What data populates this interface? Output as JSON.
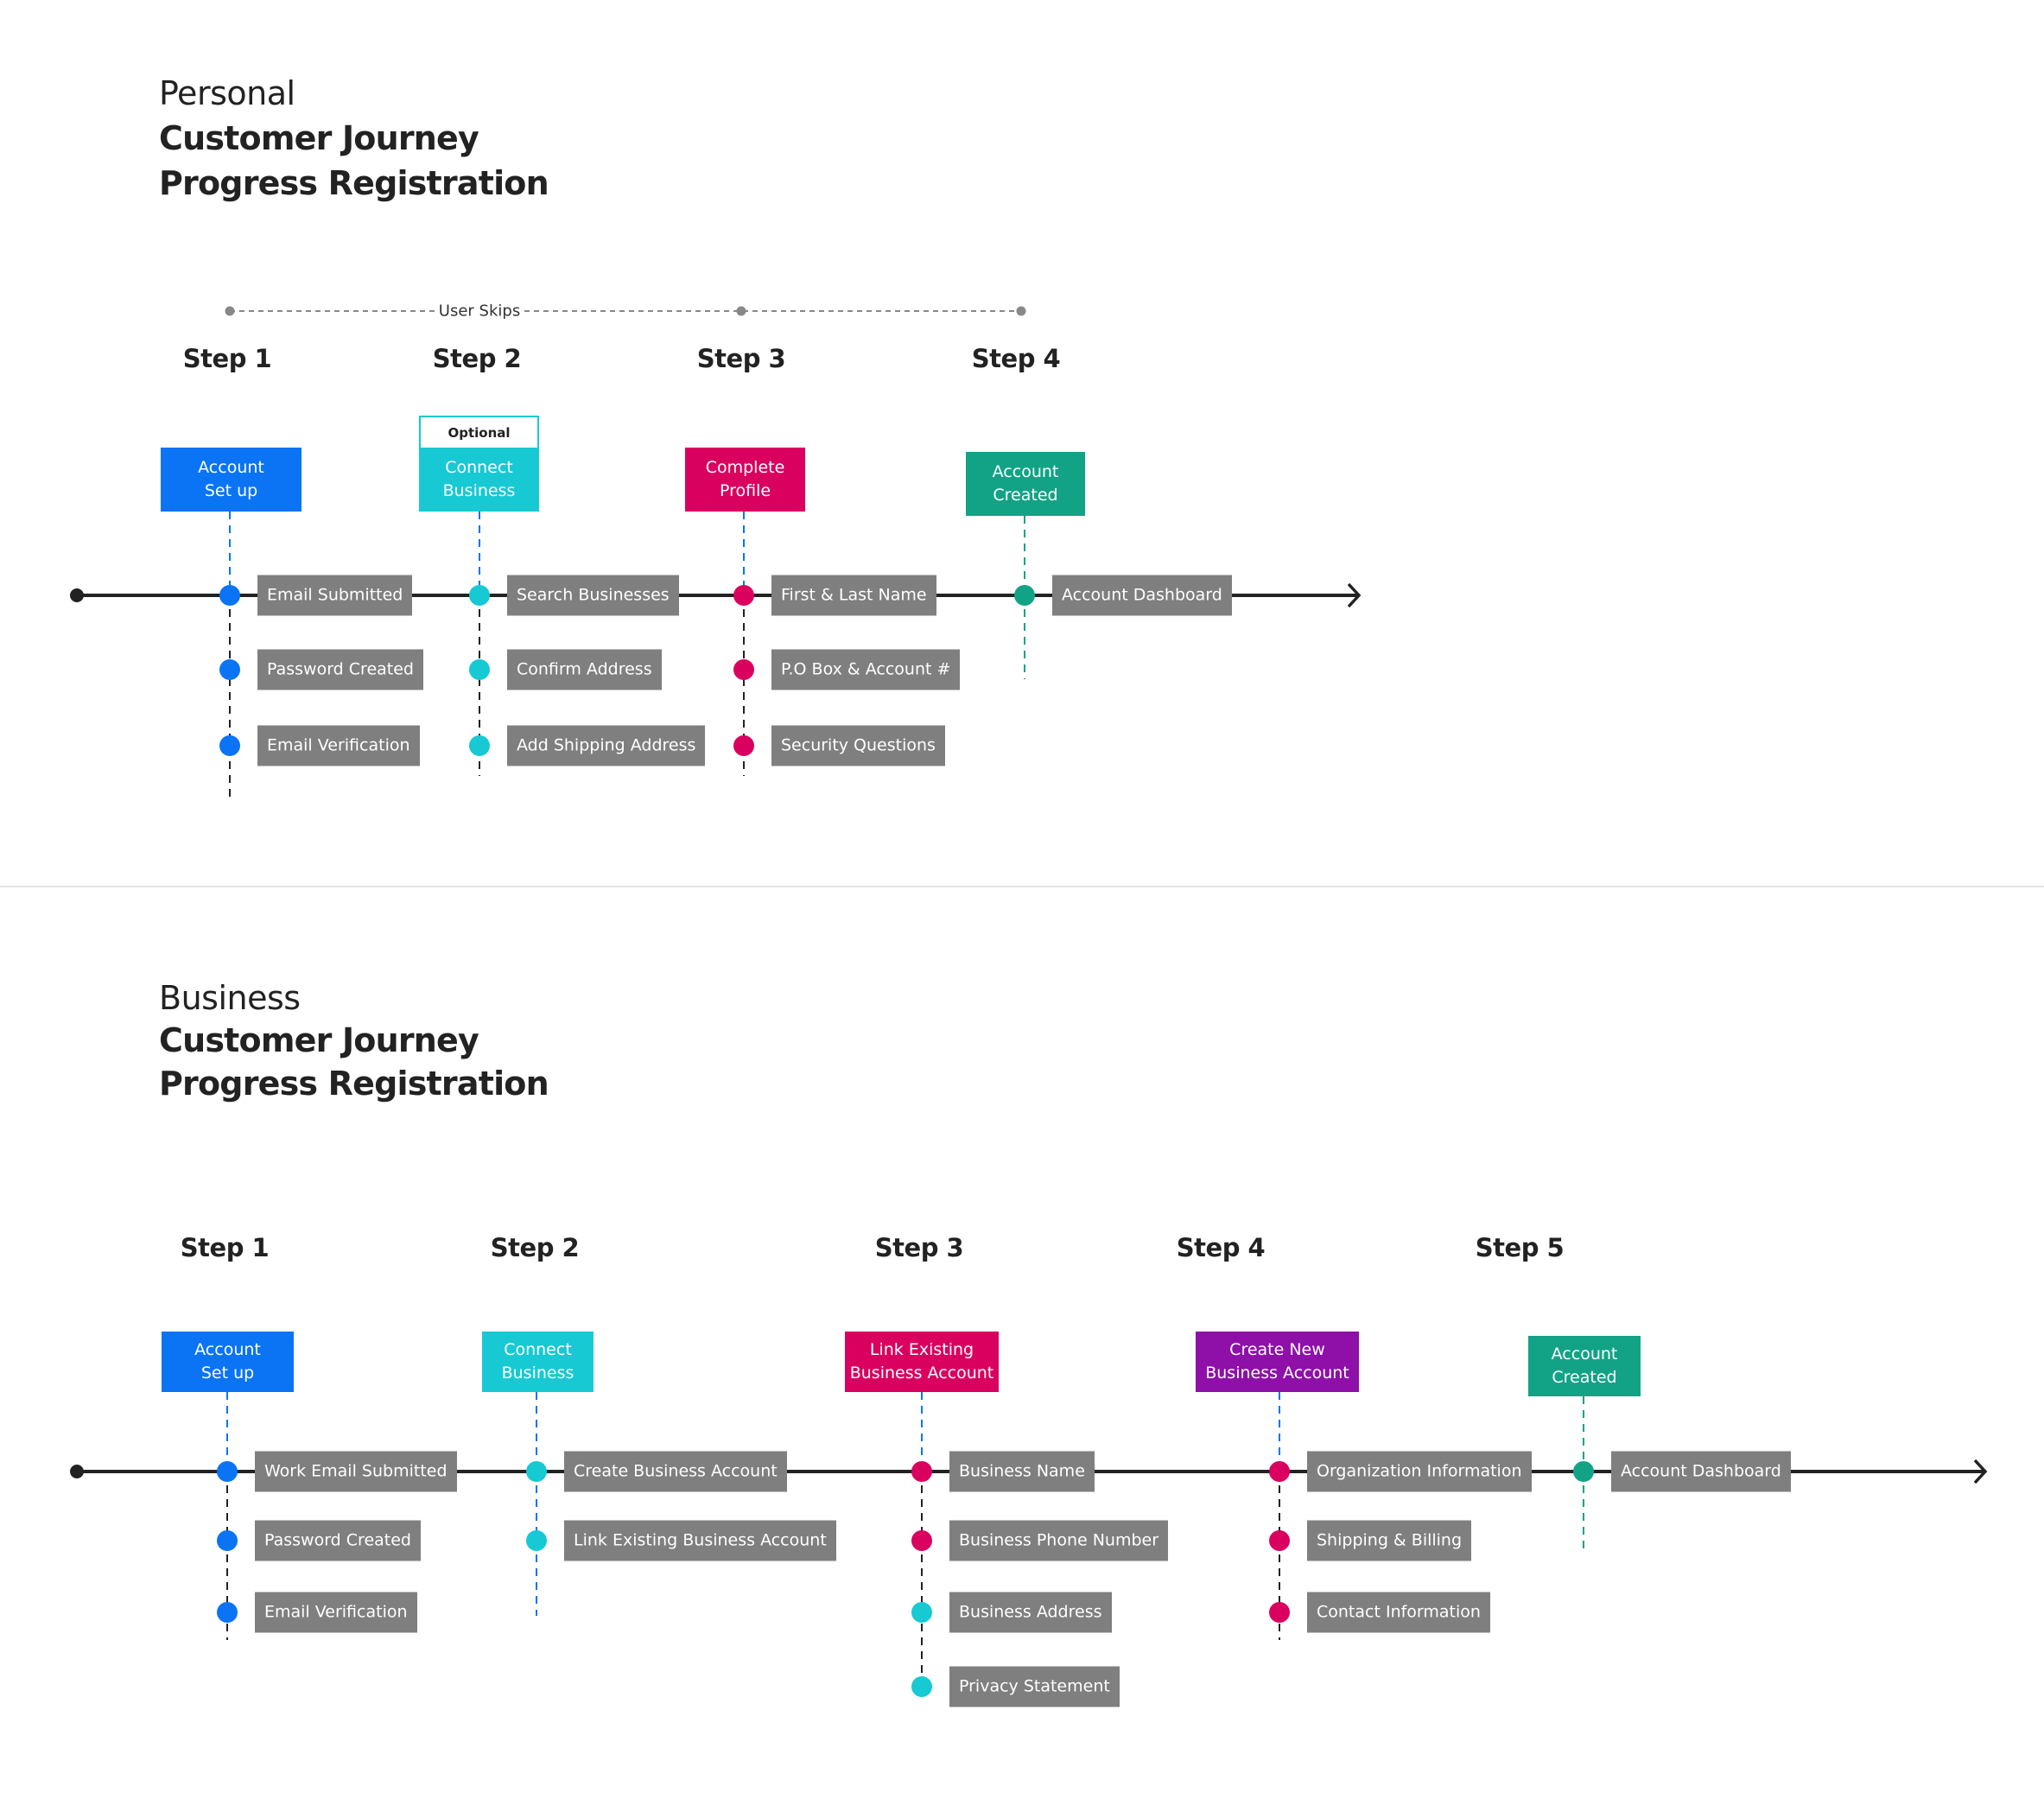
{
  "colors": {
    "blue": "#0a74f5",
    "cyan": "#17c9d3",
    "magenta": "#d9005f",
    "green": "#12a386",
    "purple": "#8e10a8",
    "label_gray": "#7f7f7f",
    "line": "#222222",
    "skip_gray": "#888888"
  },
  "personal": {
    "title_light": "Personal",
    "title_line1": "Customer Journey",
    "title_line2": "Progress Registration",
    "skip_annotation": "User Skips",
    "steps": [
      {
        "step": "Step 1",
        "phase": "Account\nSet up",
        "color": "blue",
        "items": [
          {
            "label": "Email Submitted",
            "color": "blue"
          },
          {
            "label": "Password Created",
            "color": "blue"
          },
          {
            "label": "Email Verification",
            "color": "blue"
          }
        ]
      },
      {
        "step": "Step 2",
        "phase": "Connect\nBusiness",
        "badge": "Optional",
        "color": "cyan",
        "items": [
          {
            "label": "Search Businesses",
            "color": "cyan"
          },
          {
            "label": "Confirm Address",
            "color": "cyan"
          },
          {
            "label": "Add Shipping Address",
            "color": "cyan"
          }
        ]
      },
      {
        "step": "Step 3",
        "phase": "Complete\nProfile",
        "color": "magenta",
        "items": [
          {
            "label": "First & Last Name",
            "color": "magenta"
          },
          {
            "label": "P.O Box & Account #",
            "color": "magenta"
          },
          {
            "label": "Security Questions",
            "color": "magenta"
          }
        ]
      },
      {
        "step": "Step 4",
        "phase": "Account\nCreated",
        "color": "green",
        "items": [
          {
            "label": "Account Dashboard",
            "color": "green"
          }
        ]
      }
    ]
  },
  "business": {
    "title_light": "Business",
    "title_line1": "Customer Journey",
    "title_line2": "Progress Registration",
    "steps": [
      {
        "step": "Step 1",
        "phase": "Account\nSet up",
        "color": "blue",
        "items": [
          {
            "label": "Work Email Submitted",
            "color": "blue"
          },
          {
            "label": "Password Created",
            "color": "blue"
          },
          {
            "label": "Email Verification",
            "color": "blue"
          }
        ]
      },
      {
        "step": "Step 2",
        "phase": "Connect\nBusiness",
        "color": "cyan",
        "items": [
          {
            "label": "Create Business Account",
            "color": "cyan"
          },
          {
            "label": "Link Existing Business Account",
            "color": "cyan"
          }
        ]
      },
      {
        "step": "Step 3",
        "phase": "Link Existing\nBusiness Account",
        "color": "magenta",
        "items": [
          {
            "label": "Business Name",
            "color": "magenta"
          },
          {
            "label": "Business Phone Number",
            "color": "magenta"
          },
          {
            "label": "Business Address",
            "color": "cyan"
          },
          {
            "label": "Privacy Statement",
            "color": "cyan"
          }
        ]
      },
      {
        "step": "Step 4",
        "phase": "Create New\nBusiness Account",
        "color": "purple",
        "items": [
          {
            "label": "Organization Information",
            "color": "magenta"
          },
          {
            "label": "Shipping & Billing",
            "color": "magenta"
          },
          {
            "label": "Contact Information",
            "color": "magenta"
          }
        ]
      },
      {
        "step": "Step 5",
        "phase": "Account\nCreated",
        "color": "green",
        "items": [
          {
            "label": "Account Dashboard",
            "color": "green"
          }
        ]
      }
    ]
  }
}
